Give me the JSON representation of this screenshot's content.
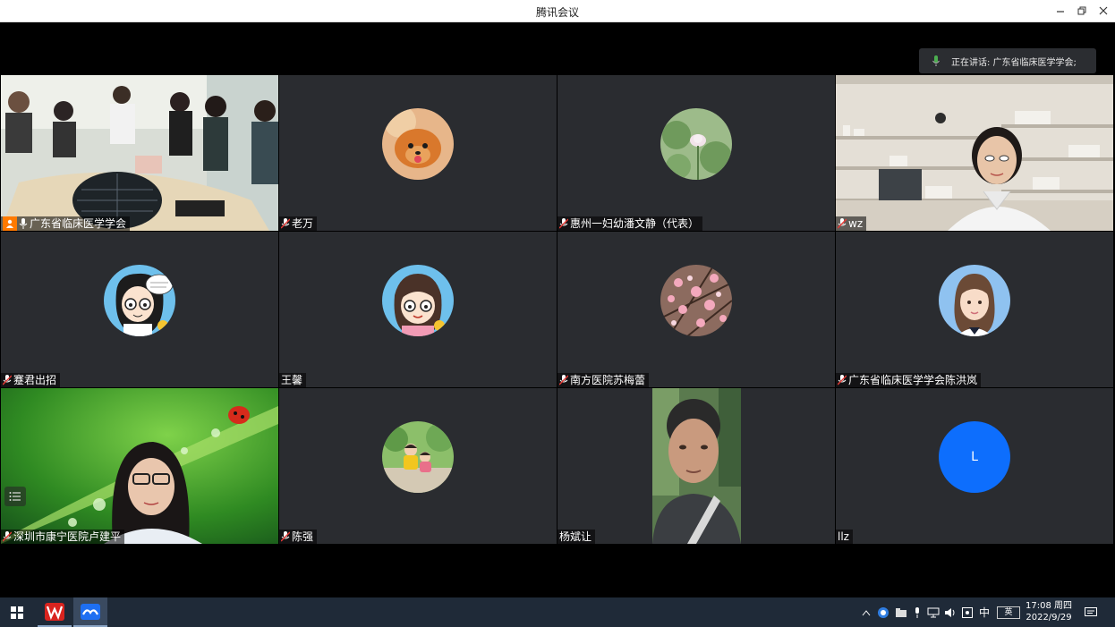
{
  "window": {
    "title": "腾讯会议"
  },
  "speaking": {
    "text": "正在讲话: 广东省临床医学学会;"
  },
  "participants": [
    {
      "name": "广东省临床医学学会",
      "host": true
    },
    {
      "name": "老万"
    },
    {
      "name": "惠州一妇幼潘文静（代表）"
    },
    {
      "name": "wz"
    },
    {
      "name": "蹇君出招"
    },
    {
      "name": "王馨"
    },
    {
      "name": "南方医院苏梅蕾"
    },
    {
      "name": "广东省临床医学学会陈洪岚"
    },
    {
      "name": "深圳市康宁医院卢建平"
    },
    {
      "name": "陈强"
    },
    {
      "name": "杨斌让"
    },
    {
      "name": "llz",
      "avatar_letter": "L"
    }
  ],
  "taskbar": {
    "clock_time": "17:08 周四",
    "clock_date": "2022/9/29",
    "ime": "中",
    "ime2": "英"
  }
}
